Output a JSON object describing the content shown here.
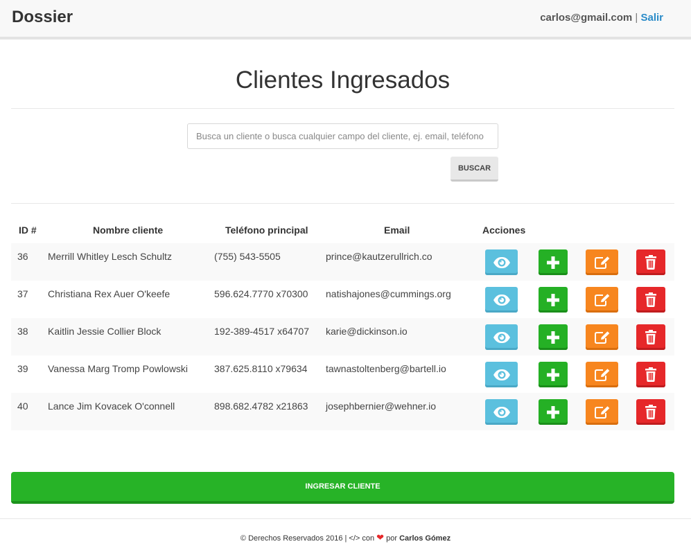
{
  "navbar": {
    "brand": "Dossier",
    "user_email": "carlos@gmail.com",
    "separator": "|",
    "logout_label": "Salir"
  },
  "main": {
    "title": "Clientes Ingresados",
    "search": {
      "placeholder": "Busca un cliente o busca cualquier campo del cliente, ej. email, teléfono",
      "value": "",
      "button_label": "BUSCAR"
    },
    "table": {
      "headers": {
        "id": "ID #",
        "name": "Nombre cliente",
        "phone": "Teléfono principal",
        "email": "Email",
        "actions": "Acciones"
      },
      "rows": [
        {
          "id": "36",
          "name": "Merrill Whitley Lesch Schultz",
          "phone": "(755) 543-5505",
          "email": "prince@kautzerullrich.co"
        },
        {
          "id": "37",
          "name": "Christiana Rex Auer O'keefe",
          "phone": "596.624.7770 x70300",
          "email": "natishajones@cummings.org"
        },
        {
          "id": "38",
          "name": "Kaitlin Jessie Collier Block",
          "phone": "192-389-4517 x64707",
          "email": "karie@dickinson.io"
        },
        {
          "id": "39",
          "name": "Vanessa Marg Tromp Powlowski",
          "phone": "387.625.8110 x79634",
          "email": "tawnastoltenberg@bartell.io"
        },
        {
          "id": "40",
          "name": "Lance Jim Kovacek O'connell",
          "phone": "898.682.4782 x21863",
          "email": "josephbernier@wehner.io"
        }
      ],
      "action_icons": [
        "eye-icon",
        "plus-icon",
        "edit-icon",
        "trash-icon"
      ]
    },
    "add_client_label": "INGRESAR CLIENTE"
  },
  "footer": {
    "prefix": "© Derechos Reservados 2016 | </> con",
    "middle": "por",
    "author": "Carlos Gómez"
  },
  "colors": {
    "view": "#5bc0de",
    "add": "#25b025",
    "edit": "#f7861f",
    "delete": "#e6282a",
    "link": "#2a8bc8"
  }
}
